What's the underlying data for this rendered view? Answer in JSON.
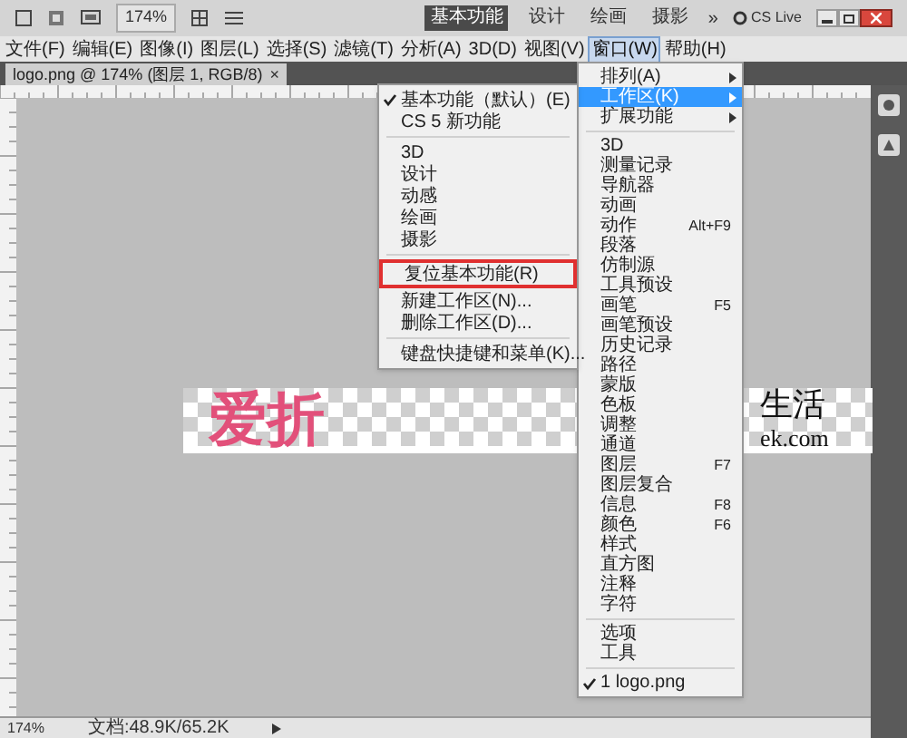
{
  "toolbar": {
    "zoom": "174%",
    "workspaces": [
      {
        "label": "基本功能",
        "selected": true
      },
      {
        "label": "设计",
        "selected": false
      },
      {
        "label": "绘画",
        "selected": false
      },
      {
        "label": "摄影",
        "selected": false
      }
    ],
    "more": "»",
    "cs_live": "CS Live"
  },
  "menu_bar": [
    {
      "label": "文件(F)",
      "selected": false
    },
    {
      "label": "编辑(E)",
      "selected": false
    },
    {
      "label": "图像(I)",
      "selected": false
    },
    {
      "label": "图层(L)",
      "selected": false
    },
    {
      "label": "选择(S)",
      "selected": false
    },
    {
      "label": "滤镜(T)",
      "selected": false
    },
    {
      "label": "分析(A)",
      "selected": false
    },
    {
      "label": "3D(D)",
      "selected": false
    },
    {
      "label": "视图(V)",
      "selected": false
    },
    {
      "label": "窗口(W)",
      "selected": true
    },
    {
      "label": "帮助(H)",
      "selected": false
    }
  ],
  "document_tab": {
    "title": "logo.png @ 174% (图层 1, RGB/8)",
    "close": "×"
  },
  "logo": {
    "left_text": "爱折",
    "right_text": "生活",
    "domain_text": "ek.com"
  },
  "window_menu": {
    "items": [
      {
        "kind": "submenu",
        "label": "排列(A)",
        "selected": false,
        "checked": false
      },
      {
        "kind": "submenu",
        "label": "工作区(K)",
        "selected": true,
        "checked": false
      },
      {
        "kind": "submenu",
        "label": "扩展功能",
        "selected": false,
        "checked": false
      },
      {
        "kind": "separator"
      },
      {
        "kind": "item",
        "label": "3D",
        "selected": false,
        "checked": false
      },
      {
        "kind": "item",
        "label": "测量记录",
        "selected": false,
        "checked": false
      },
      {
        "kind": "item",
        "label": "导航器",
        "selected": false,
        "checked": false
      },
      {
        "kind": "item",
        "label": "动画",
        "selected": false,
        "checked": false
      },
      {
        "kind": "item",
        "label": "动作",
        "shortcut": "Alt+F9",
        "selected": false,
        "checked": false
      },
      {
        "kind": "item",
        "label": "段落",
        "selected": false,
        "checked": false
      },
      {
        "kind": "item",
        "label": "仿制源",
        "selected": false,
        "checked": false
      },
      {
        "kind": "item",
        "label": "工具预设",
        "selected": false,
        "checked": false
      },
      {
        "kind": "item",
        "label": "画笔",
        "shortcut": "F5",
        "selected": false,
        "checked": false
      },
      {
        "kind": "item",
        "label": "画笔预设",
        "selected": false,
        "checked": false
      },
      {
        "kind": "item",
        "label": "历史记录",
        "selected": false,
        "checked": false
      },
      {
        "kind": "item",
        "label": "路径",
        "selected": false,
        "checked": false
      },
      {
        "kind": "item",
        "label": "蒙版",
        "selected": false,
        "checked": false
      },
      {
        "kind": "item",
        "label": "色板",
        "selected": false,
        "checked": false
      },
      {
        "kind": "item",
        "label": "调整",
        "selected": false,
        "checked": false
      },
      {
        "kind": "item",
        "label": "通道",
        "selected": false,
        "checked": false
      },
      {
        "kind": "item",
        "label": "图层",
        "shortcut": "F7",
        "selected": false,
        "checked": false
      },
      {
        "kind": "item",
        "label": "图层复合",
        "selected": false,
        "checked": false
      },
      {
        "kind": "item",
        "label": "信息",
        "shortcut": "F8",
        "selected": false,
        "checked": false
      },
      {
        "kind": "item",
        "label": "颜色",
        "shortcut": "F6",
        "selected": false,
        "checked": false
      },
      {
        "kind": "item",
        "label": "样式",
        "selected": false,
        "checked": false
      },
      {
        "kind": "item",
        "label": "直方图",
        "selected": false,
        "checked": false
      },
      {
        "kind": "item",
        "label": "注释",
        "selected": false,
        "checked": false
      },
      {
        "kind": "item",
        "label": "字符",
        "selected": false,
        "checked": false
      },
      {
        "kind": "separator"
      },
      {
        "kind": "item",
        "label": "选项",
        "selected": false,
        "checked": false
      },
      {
        "kind": "item",
        "label": "工具",
        "selected": false,
        "checked": false
      },
      {
        "kind": "separator"
      },
      {
        "kind": "item",
        "label": "1 logo.png",
        "selected": false,
        "checked": true
      }
    ]
  },
  "workspace_submenu": {
    "items": [
      {
        "kind": "item",
        "label": "基本功能（默认）(E)",
        "checked": true,
        "annotated": false
      },
      {
        "kind": "item",
        "label": "CS 5 新功能",
        "checked": false,
        "annotated": false
      },
      {
        "kind": "separator"
      },
      {
        "kind": "item",
        "label": "3D",
        "checked": false,
        "annotated": false
      },
      {
        "kind": "item",
        "label": "设计",
        "checked": false,
        "annotated": false
      },
      {
        "kind": "item",
        "label": "动感",
        "checked": false,
        "annotated": false
      },
      {
        "kind": "item",
        "label": "绘画",
        "checked": false,
        "annotated": false
      },
      {
        "kind": "item",
        "label": "摄影",
        "checked": false,
        "annotated": false
      },
      {
        "kind": "separator"
      },
      {
        "kind": "item",
        "label": "复位基本功能(R)",
        "checked": false,
        "annotated": true
      },
      {
        "kind": "item",
        "label": "新建工作区(N)...",
        "checked": false,
        "annotated": false
      },
      {
        "kind": "item",
        "label": "删除工作区(D)...",
        "checked": false,
        "annotated": false
      },
      {
        "kind": "separator"
      },
      {
        "kind": "item",
        "label": "键盘快捷键和菜单(K)...",
        "checked": false,
        "annotated": false
      }
    ]
  },
  "status_bar": {
    "zoom": "174%",
    "document": "文档:48.9K/65.2K"
  }
}
